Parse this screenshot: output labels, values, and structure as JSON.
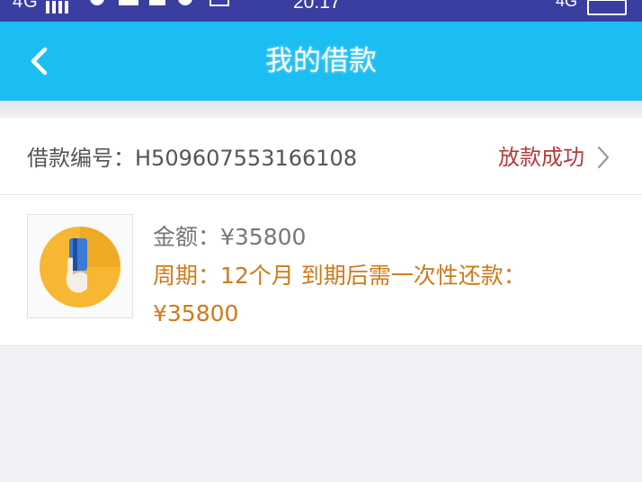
{
  "status_bar": {
    "signal_text": "4G",
    "time": "20:17",
    "network_right": "4G"
  },
  "header": {
    "title": "我的借款"
  },
  "loan": {
    "number_label": "借款编号：",
    "number_value": "H509607553166108",
    "status": "放款成功",
    "amount_text": "金额：¥35800",
    "period_text": "周期：12个月 到期后需一次性还款：¥35800"
  },
  "colors": {
    "accent": "#1bbef3",
    "status_bar": "#3a3ea0",
    "status_text": "#b53a3a",
    "period_text": "#d07a1a"
  },
  "icons": {
    "back": "chevron-left-icon",
    "detail": "chevron-right-icon",
    "thumbnail": "payment-card-icon"
  }
}
